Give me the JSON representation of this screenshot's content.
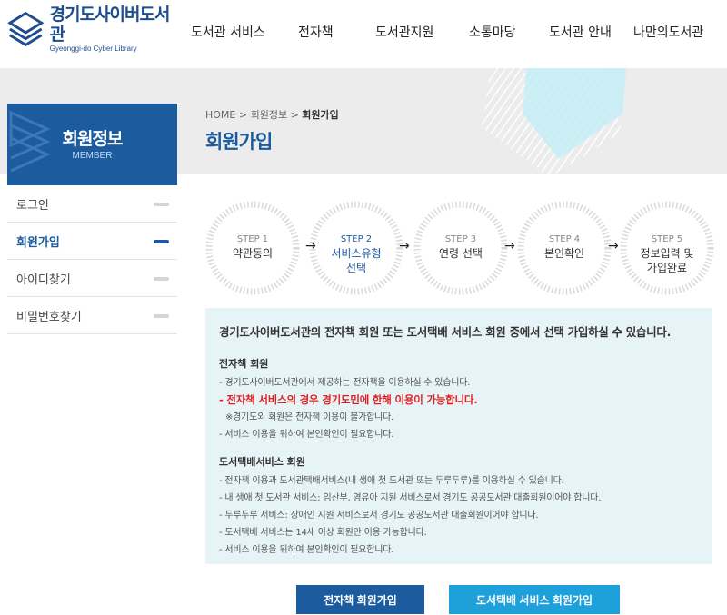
{
  "header": {
    "logo_name": "경기도사이버도서관",
    "logo_sub": "Gyeonggi-do Cyber Library",
    "nav": [
      "도서관 서비스",
      "전자책",
      "도서관지원",
      "소통마당",
      "도서관 안내",
      "나만의도서관"
    ]
  },
  "sidebar": {
    "title": "회원정보",
    "subtitle": "MEMBER",
    "items": [
      {
        "label": "로그인",
        "active": false
      },
      {
        "label": "회원가입",
        "active": true
      },
      {
        "label": "아이디찾기",
        "active": false
      },
      {
        "label": "비밀번호찾기",
        "active": false
      }
    ]
  },
  "breadcrumb": {
    "home": "HOME",
    "sep1": " > ",
    "level1": "회원정보",
    "sep2": " > ",
    "current": "회원가입"
  },
  "page_title": "회원가입",
  "steps": [
    {
      "num": "STEP 1",
      "label": "약관동의"
    },
    {
      "num": "STEP 2",
      "label": "서비스유형\n선택",
      "current": true
    },
    {
      "num": "STEP 3",
      "label": "연령 선택"
    },
    {
      "num": "STEP 4",
      "label": "본인확인"
    },
    {
      "num": "STEP 5",
      "label": "정보입력 및\n가입완료"
    }
  ],
  "arrow_glyph": "→",
  "info": {
    "intro": "경기도사이버도서관의 전자책 회원 또는 도서택배 서비스 회원 중에서 선택 가입하실 수 있습니다.",
    "ebook_heading": "전자책 회원",
    "ebook_line1": "- 경기도사이버도서관에서 제공하는 전자책을 이용하실 수 있습니다.",
    "ebook_alert": "- 전자책 서비스의 경우 경기도민에 한해 이용이 가능합니다.",
    "ebook_note": "※경기도외 회원은 전자책 이용이 불가합니다.",
    "ebook_line2": "- 서비스 이용을 위하여 본인확인이 필요합니다.",
    "delivery_heading": "도서택배서비스 회원",
    "delivery_line1": "- 전자책 이용과 도서관택배서비스(내 생애 첫 도서관 또는 두루두루)를 이용하실 수 있습니다.",
    "delivery_line2": "- 내 생애 첫 도서관 서비스: 임산부, 영유아 지원 서비스로서 경기도 공공도서관 대출회원이어야 합니다.",
    "delivery_line3": "- 두루두루 서비스: 장애인 지원 서비스로서 경기도 공공도서관 대출회원이어야 합니다.",
    "delivery_line4": "- 도서택배 서비스는 14세 이상 회원만 이용 가능합니다.",
    "delivery_line5": "- 서비스 이용을 위하여 본인확인이 필요합니다."
  },
  "buttons": {
    "ebook": "전자책 회원가입",
    "delivery": "도서택배 서비스 회원가입"
  },
  "colors": {
    "primary": "#1d5b9f",
    "accent": "#1ea0da",
    "alert": "#e02020",
    "info_bg": "#e7f4f7"
  }
}
